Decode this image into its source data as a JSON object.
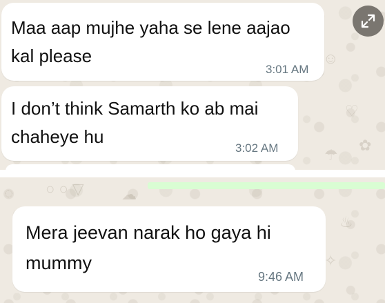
{
  "messages": [
    {
      "text": "Maa aap mujhe yaha se lene aajao\nkal please",
      "time": "3:01 AM"
    },
    {
      "text": "I don’t think Samarth ko ab mai\nchaheye hu",
      "time": "3:02 AM"
    },
    {
      "text": "Mera jeevan narak ho gaya hi\nmummy",
      "time": "9:46 AM"
    }
  ],
  "icons": {
    "expand": "expand-icon"
  },
  "colors": {
    "chat_background": "#efeae2",
    "incoming_bubble": "#ffffff",
    "outgoing_bubble_strip": "#d9fdd3",
    "timestamp": "#667781"
  }
}
